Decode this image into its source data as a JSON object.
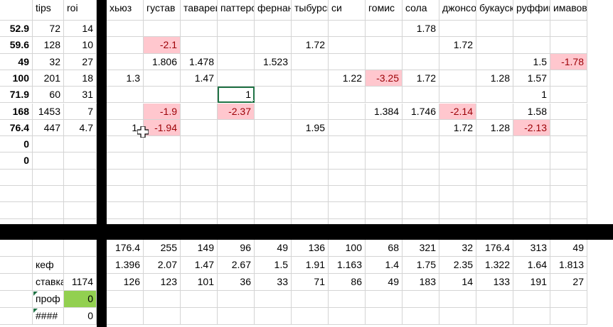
{
  "left_headers": [
    "",
    "tips",
    "roi"
  ],
  "left_rows": [
    [
      "52.9",
      "72",
      "14"
    ],
    [
      "59.6",
      "128",
      "10"
    ],
    [
      "49",
      "32",
      "27"
    ],
    [
      "100",
      "201",
      "18"
    ],
    [
      "71.9",
      "60",
      "31"
    ],
    [
      "168",
      "1453",
      "7"
    ],
    [
      "76.4",
      "447",
      "4.7"
    ],
    [
      "0",
      "",
      ""
    ],
    [
      "0",
      "",
      ""
    ],
    [
      "",
      "",
      ""
    ],
    [
      "",
      "",
      ""
    ],
    [
      "",
      "",
      ""
    ],
    [
      "",
      "",
      ""
    ]
  ],
  "player_headers": [
    "хьюз",
    "густав",
    "тавареш",
    "паттерсон",
    "фернандес",
    "тыбурский",
    "си",
    "гомис",
    "сола",
    "джонсон",
    "букауски",
    "руффини",
    "имавов"
  ],
  "grid_rows": [
    [
      "",
      "",
      "",
      "",
      "",
      "",
      "",
      "",
      "1.78",
      "",
      "",
      "",
      ""
    ],
    [
      "",
      "-2.1",
      "",
      "",
      "",
      "1.72",
      "",
      "",
      "",
      "1.72",
      "",
      "",
      ""
    ],
    [
      "",
      "1.806",
      "1.478",
      "",
      "1.523",
      "",
      "",
      "",
      "",
      "",
      "",
      "1.5",
      "-1.78"
    ],
    [
      "1.3",
      "",
      "1.47",
      "",
      "",
      "",
      "1.22",
      "-3.25",
      "1.72",
      "",
      "1.28",
      "1.57",
      ""
    ],
    [
      "",
      "",
      "",
      "1",
      "",
      "",
      "",
      "",
      "",
      "",
      "",
      "1",
      ""
    ],
    [
      "",
      "-1.9",
      "",
      "-2.37",
      "",
      "",
      "",
      "1.384",
      "1.746",
      "-2.14",
      "",
      "1.58",
      ""
    ],
    [
      "1.",
      "-1.94",
      "",
      "",
      "",
      "1.95",
      "",
      "",
      "",
      "1.72",
      "1.28",
      "-2.13",
      ""
    ],
    [
      "",
      "",
      "",
      "",
      "",
      "",
      "",
      "",
      "",
      "",
      "",
      "",
      ""
    ],
    [
      "",
      "",
      "",
      "",
      "",
      "",
      "",
      "",
      "",
      "",
      "",
      "",
      ""
    ],
    [
      "",
      "",
      "",
      "",
      "",
      "",
      "",
      "",
      "",
      "",
      "",
      "",
      ""
    ],
    [
      "",
      "",
      "",
      "",
      "",
      "",
      "",
      "",
      "",
      "",
      "",
      "",
      ""
    ],
    [
      "",
      "",
      "",
      "",
      "",
      "",
      "",
      "",
      "",
      "",
      "",
      "",
      ""
    ],
    [
      "",
      "",
      "",
      "",
      "",
      "",
      "",
      "",
      "",
      "",
      "",
      "",
      ""
    ]
  ],
  "pink_cells": [
    [
      1,
      1
    ],
    [
      2,
      12
    ],
    [
      3,
      7
    ],
    [
      5,
      1
    ],
    [
      5,
      3
    ],
    [
      5,
      9
    ],
    [
      6,
      1
    ],
    [
      6,
      11
    ]
  ],
  "selected_cell": [
    4,
    3
  ],
  "bottom_left": [
    [
      "",
      ""
    ],
    [
      "кеф",
      ""
    ],
    [
      "ставка",
      "1174"
    ],
    [
      "проф",
      "0"
    ],
    [
      "####",
      "0"
    ]
  ],
  "bottom_rows": [
    [
      "176.4",
      "255",
      "149",
      "96",
      "49",
      "136",
      "100",
      "68",
      "321",
      "32",
      "176.4",
      "313",
      "49"
    ],
    [
      "1.396",
      "2.07",
      "1.47",
      "2.67",
      "1.5",
      "1.91",
      "1.163",
      "1.4",
      "1.75",
      "2.35",
      "1.322",
      "1.64",
      "1.813"
    ],
    [
      "126",
      "123",
      "101",
      "36",
      "33",
      "71",
      "86",
      "49",
      "183",
      "14",
      "133",
      "191",
      "27"
    ],
    [
      "",
      "",
      "",
      "",
      "",
      "",
      "",
      "",
      "",
      "",
      "",
      "",
      ""
    ],
    [
      "",
      "",
      "",
      "",
      "",
      "",
      "",
      "",
      "",
      "",
      "",
      "",
      ""
    ]
  ],
  "colors": {
    "pink_fill": "#ffc7ce",
    "pink_text": "#9c0006",
    "green_fill": "#92d050",
    "selection": "#217346"
  }
}
